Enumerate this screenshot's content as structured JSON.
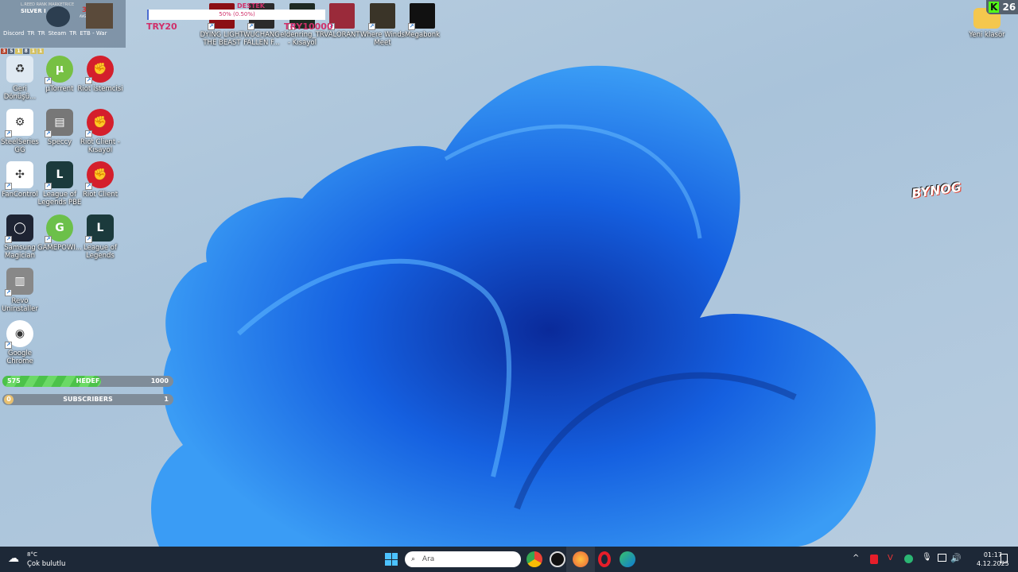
{
  "overlay": {
    "rank_caption": "L.REED RANK MARKETRICE",
    "rank": "SILVER I",
    "place_value": "3.2",
    "place_label": "AVG. PLACE",
    "small_items": [
      "Discord",
      "TR",
      "TR",
      "Steam",
      "TR",
      "ETB - War"
    ],
    "badges": [
      "3",
      "5",
      "1",
      "8",
      "1",
      "1"
    ]
  },
  "donation": {
    "title": "DESTEK",
    "progress_text": "50% (0.50%)",
    "progress": 0.5,
    "min_label": "TRY20",
    "max_label": "TRY10000"
  },
  "top_icons": [
    {
      "label": "DYING LIGHT THE BEAST",
      "color": "#8b0f14"
    },
    {
      "label": "WUCHANG FALLEN F...",
      "color": "#2b2b2b"
    },
    {
      "label": "eldenring_TR - Kısayol",
      "color": "#1e2a22"
    },
    {
      "label": "VALORANT",
      "color": "#9a2a3a"
    },
    {
      "label": "Where Winds Meet",
      "color": "#3a3428"
    },
    {
      "label": "Megabonk",
      "color": "#111"
    }
  ],
  "desktop_icons": [
    {
      "label": "Geri Dönüşü...",
      "color": "#dfe9f2",
      "glyph": "♻"
    },
    {
      "label": "µTorrent",
      "color": "#77c043",
      "glyph": "µ"
    },
    {
      "label": "Riot İstemcisi",
      "color": "#d41f2c",
      "glyph": "✊"
    },
    {
      "label": "SteelSeries GG",
      "color": "#fff",
      "glyph": "⚙"
    },
    {
      "label": "Speccy",
      "color": "#777",
      "glyph": "▤"
    },
    {
      "label": "Riot Client - Kısayol",
      "color": "#d41f2c",
      "glyph": "✊"
    },
    {
      "label": "FanControl",
      "color": "#fff",
      "glyph": "✣"
    },
    {
      "label": "League of Legends PBE",
      "color": "#1b3a3c",
      "glyph": "L"
    },
    {
      "label": "Riot Client",
      "color": "#d41f2c",
      "glyph": "✊"
    },
    {
      "label": "Samsung Magician",
      "color": "#1e2433",
      "glyph": "◯"
    },
    {
      "label": "GAMEPOWI...",
      "color": "#6cc04a",
      "glyph": "G"
    },
    {
      "label": "League of Legends",
      "color": "#1b3a3c",
      "glyph": "L"
    },
    {
      "label": "Revo Uninstaller",
      "color": "#888",
      "glyph": "▥"
    },
    {
      "label": "Google Chrome",
      "color": "#fff",
      "glyph": "◉"
    }
  ],
  "folder": {
    "label": "Yeni klasör",
    "badge_letter": "K",
    "badge_count": "26"
  },
  "goal_bar": {
    "current": "575",
    "label": "HEDEF",
    "target": "1000",
    "progress": 0.575
  },
  "subs_bar": {
    "current": "0",
    "label": "SUBSCRIBERS",
    "target": "1"
  },
  "logo_text": "BYNOG",
  "taskbar": {
    "temp": "8°C",
    "weather": "Çok bulutlu",
    "search_placeholder": "Ara",
    "time": "01:17",
    "date": "4.12.2025"
  }
}
